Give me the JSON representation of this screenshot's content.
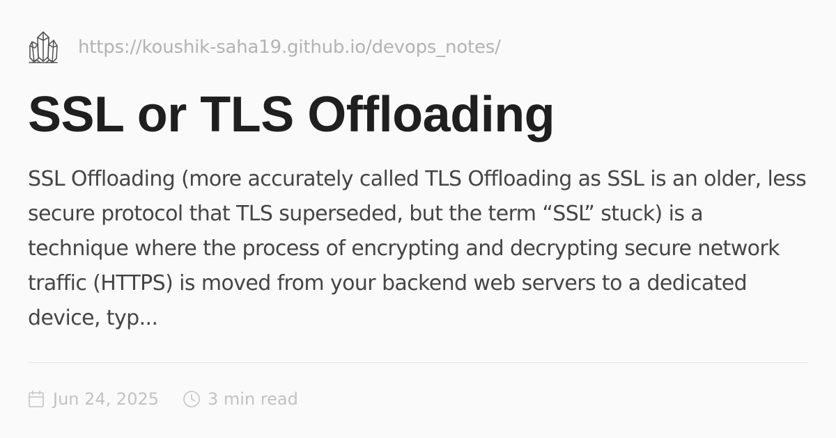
{
  "site": {
    "url": "https://koushik-saha19.github.io/devops_notes/",
    "logo_icon": "crystal-cluster-icon"
  },
  "post": {
    "title": "SSL or TLS Offloading",
    "description": "SSL Offloading (more accurately called TLS Offloading as SSL is an older, less secure protocol that TLS superseded, but the term “SSL” stuck) is a technique where the process of encrypting and decrypting secure network traffic (HTTPS) is moved from your backend web servers to a dedicated device, typ...",
    "date": "Jun 24, 2025",
    "read_time": "3 min read"
  },
  "icons": {
    "date": "calendar-icon",
    "read_time": "clock-icon"
  },
  "colors": {
    "background": "#fafafa",
    "title": "#1f1f1f",
    "body": "#454545",
    "muted": "#b3b3b3",
    "divider": "#e6e6e6"
  }
}
